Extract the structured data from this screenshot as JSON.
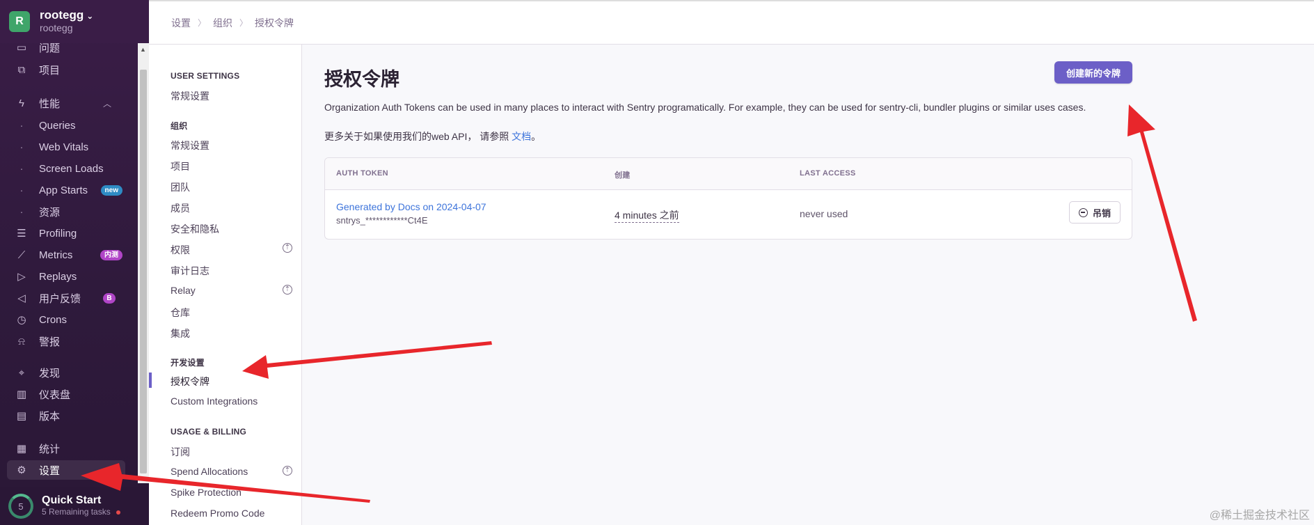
{
  "org": {
    "avatar_letter": "R",
    "name": "rootegg",
    "chevron": "⌄",
    "subtitle": "rootegg"
  },
  "sidebar": {
    "items": [
      {
        "label": "问题",
        "icon": "inbox-icon"
      },
      {
        "label": "项目",
        "icon": "code-icon"
      },
      {
        "label": "性能",
        "icon": "lightning-icon"
      },
      {
        "label": "Queries"
      },
      {
        "label": "Web Vitals"
      },
      {
        "label": "Screen Loads"
      },
      {
        "label": "App Starts",
        "badge": "new"
      },
      {
        "label": "资源"
      },
      {
        "label": "Profiling",
        "icon": "profiling-icon"
      },
      {
        "label": "Metrics",
        "icon": "chart-icon",
        "badge": "内测"
      },
      {
        "label": "Replays",
        "icon": "play-icon"
      },
      {
        "label": "用户反馈",
        "icon": "megaphone-icon",
        "badge": "B"
      },
      {
        "label": "Crons",
        "icon": "clock-icon"
      },
      {
        "label": "警报",
        "icon": "siren-icon"
      },
      {
        "label": "发现",
        "icon": "telescope-icon"
      },
      {
        "label": "仪表盘",
        "icon": "dashboard-icon"
      },
      {
        "label": "版本",
        "icon": "package-icon"
      },
      {
        "label": "统计",
        "icon": "stats-icon"
      },
      {
        "label": "设置",
        "icon": "gear-icon"
      }
    ],
    "collapse_chevron": "︿"
  },
  "quick_start": {
    "count": "5",
    "title": "Quick Start",
    "subtitle": "5 Remaining tasks"
  },
  "breadcrumb": [
    "设置",
    "组织",
    "授权令牌"
  ],
  "settings_nav": {
    "user_settings_heading": "USER SETTINGS",
    "user_items": [
      "常规设置"
    ],
    "org_heading": "组织",
    "org_items": [
      "常规设置",
      "项目",
      "团队",
      "成员",
      "安全和隐私",
      "权限",
      "审计日志",
      "Relay",
      "仓库",
      "集成"
    ],
    "dev_heading": "开发设置",
    "dev_items": [
      "授权令牌",
      "Custom Integrations"
    ],
    "billing_heading": "USAGE & BILLING",
    "billing_items": [
      "订阅",
      "Spend Allocations",
      "Spike Protection",
      "Redeem Promo Code"
    ]
  },
  "main": {
    "title": "授权令牌",
    "create_button": "创建新的令牌",
    "description": "Organization Auth Tokens can be used in many places to interact with Sentry programatically. For example, they can be used for sentry-cli, bundler plugins or similar uses cases.",
    "api_prefix": "更多关于如果使用我们的web API， 请参照 ",
    "api_link": "文档",
    "api_suffix": "。"
  },
  "table": {
    "headers": [
      "AUTH TOKEN",
      "创建",
      "LAST ACCESS"
    ],
    "rows": [
      {
        "name": "Generated by Docs on 2024-04-07",
        "token": "sntrys_************Ct4E",
        "created": "4 minutes 之前",
        "last_access": "never used",
        "revoke": "吊销"
      }
    ]
  },
  "watermark": "@稀土掘金技术社区",
  "colors": {
    "accent": "#6c5fc7",
    "link": "#3d74db",
    "sidebar_bg": "#3a1d47",
    "annotation_arrow": "#e8262b"
  }
}
